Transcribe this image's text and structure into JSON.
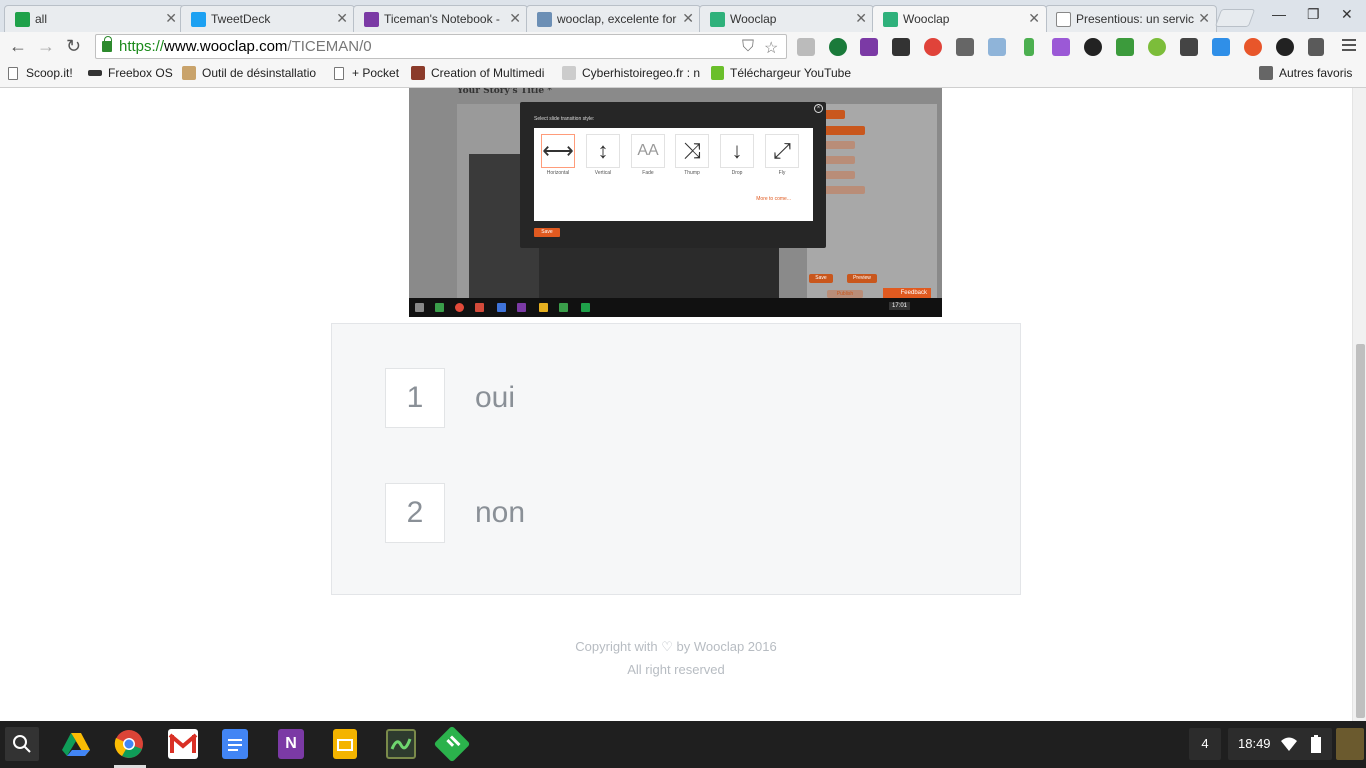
{
  "browser": {
    "tabs": [
      {
        "title": "all",
        "color": "#1fa14a"
      },
      {
        "title": "TweetDeck",
        "color": "#1da1f2"
      },
      {
        "title": "Ticeman's Notebook -",
        "color": "#7b3aa5"
      },
      {
        "title": "wooclap, excelente for",
        "color": "#6c8fb5"
      },
      {
        "title": "Wooclap",
        "color": "#2fb17b"
      },
      {
        "title": "Wooclap",
        "color": "#2fb17b"
      },
      {
        "title": "Presentious: un servic",
        "color": "#ffffff"
      }
    ],
    "active_tab_index": 5,
    "tab_close_glyph": "✕",
    "url": {
      "scheme": "https://",
      "host": "www.wooclap.com",
      "path": "/TICEMAN/0"
    },
    "bookmarks": [
      {
        "label": "Scoop.it!",
        "icon": "page-icon"
      },
      {
        "label": "Freebox OS",
        "icon": "freebox-icon"
      },
      {
        "label": "Outil de désinstallatio",
        "icon": "uninstall-icon"
      },
      {
        "label": "+ Pocket",
        "icon": "page-icon"
      },
      {
        "label": "Creation of Multimedi",
        "icon": "multimedia-icon"
      },
      {
        "label": "Cyberhistoiregeo.fr : n",
        "icon": "cyberhistoire-icon"
      },
      {
        "label": "Téléchargeur YouTube",
        "icon": "download-icon"
      }
    ],
    "other_bookmarks": "Autres favoris"
  },
  "embedded_screenshot": {
    "story_title": "Your Story's Title *",
    "modal_title": "Select slide transition style:",
    "transitions": [
      {
        "label": "Horizontal",
        "glyph": "⟷"
      },
      {
        "label": "Vertical",
        "glyph": "↕"
      },
      {
        "label": "Fade",
        "glyph": "AA"
      },
      {
        "label": "Thump",
        "glyph": "⤨"
      },
      {
        "label": "Drop",
        "glyph": "↓"
      },
      {
        "label": "Fly",
        "glyph": "⤢"
      }
    ],
    "selected_transition": "Horizontal",
    "more_to_come": "More to come...",
    "save": "Save",
    "side_save": "Save",
    "side_preview": "Preview",
    "publish": "Publish",
    "feedback": "Feedback",
    "time": "17:01"
  },
  "answers": [
    {
      "number": "1",
      "text": "oui"
    },
    {
      "number": "2",
      "text": "non"
    }
  ],
  "footer": {
    "copyright": "Copyright with ♡ by Wooclap 2016",
    "rights": "All right reserved"
  },
  "os": {
    "time": "18:49",
    "notification_count": "4"
  },
  "colors": {
    "accent": "#e05a20",
    "answer_text": "#8a9097",
    "card_bg": "#f6f7f8"
  }
}
